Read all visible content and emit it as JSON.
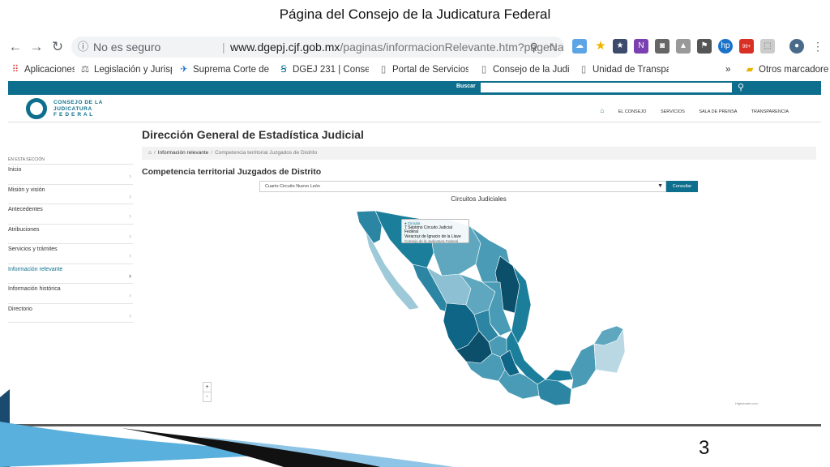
{
  "slide": {
    "title": "Página del Consejo de la Judicatura Federal",
    "page_number": "3"
  },
  "browser": {
    "insecure_label": "No es seguro",
    "url_domain": "www.dgepj.cjf.gob.mx",
    "url_path": "/paginas/informacionRelevante.htm?pageName=informacion%2F...",
    "bookmarks": [
      {
        "label": "Aplicaciones",
        "icon": "apps-grid-icon"
      },
      {
        "label": "Legislación y Jurispru",
        "icon": "gavel-icon"
      },
      {
        "label": "Suprema Corte de Ju",
        "icon": "eagle-icon"
      },
      {
        "label": "DGEJ 231 | Consejo d",
        "icon": "cjf-logo-icon"
      },
      {
        "label": "Portal de Servicios en",
        "icon": "page-icon"
      },
      {
        "label": "Consejo de la Judicat",
        "icon": "page-icon"
      },
      {
        "label": "Unidad de Transpare",
        "icon": "page-icon"
      },
      {
        "label": "Otros marcadores",
        "icon": "folder-icon"
      }
    ],
    "overflow_label": "»",
    "badge_count": "99+"
  },
  "site": {
    "search_label": "Buscar",
    "logo_line1": "CONSEJO DE LA",
    "logo_line2": "JUDICATURA",
    "logo_line3": "F E D E R A L",
    "nav": [
      "EL CONSEJO",
      "SERVICIOS",
      "SALA DE PRENSA",
      "TRANSPARENCIA"
    ],
    "page_title": "Dirección General de Estadística Judicial",
    "breadcrumb": [
      "Información relevante",
      "Competencia territorial Juzgados de Distrito"
    ],
    "sidebar_caption": "EN ESTA SECCIÓN",
    "sidebar_items": [
      {
        "label": "Inicio",
        "active": false
      },
      {
        "label": "Misión y visión",
        "active": false
      },
      {
        "label": "Antecedentes",
        "active": false
      },
      {
        "label": "Atribuciones",
        "active": false
      },
      {
        "label": "Servicios y trámites",
        "active": false
      },
      {
        "label": "Información relevante",
        "active": true
      },
      {
        "label": "Información histórica",
        "active": false
      },
      {
        "label": "Directorio",
        "active": false
      }
    ],
    "section_title": "Competencia territorial Juzgados de Distrito",
    "select_value": "Cuarto Circuito Nuevo León",
    "consult_button": "Consultar",
    "map_title": "Circuitos Judiciales",
    "tooltip": {
      "line1": "● Circuito",
      "line2": "7 Séptimo Circuito Judicial Federal",
      "line3": "Veracruz de Ignacio de la Llave",
      "line4": "Consejo de la Judicatura Federal"
    },
    "zoom_in": "+",
    "zoom_out": "-",
    "credit": "Highcharts.com"
  },
  "colors": {
    "brand": "#0d6f8d",
    "map_darkest": "#0b4f6a",
    "map_dark": "#1b7f9c",
    "map_mid": "#4a9bb5",
    "map_light": "#8cc0d2",
    "map_lightest": "#b9d8e3"
  }
}
